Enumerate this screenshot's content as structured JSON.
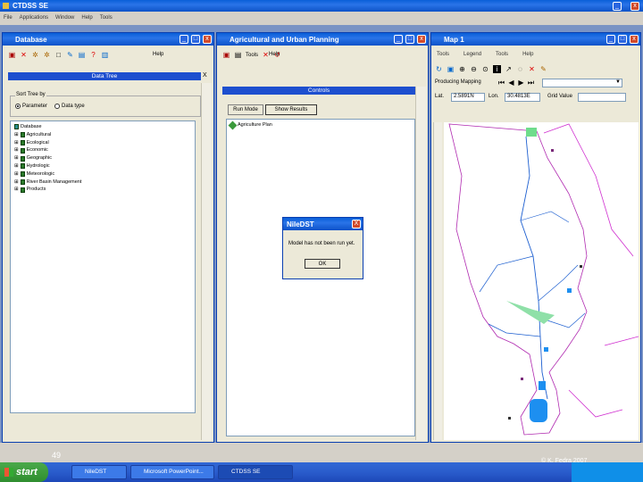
{
  "app": {
    "title": "CTDSS SE",
    "menu": [
      "File",
      "Applications",
      "Window",
      "Help",
      "Tools"
    ]
  },
  "database": {
    "title": "Database",
    "help": "Help",
    "data_tree_title": "Data Tree",
    "close_x": "X",
    "sort_label": "Sort Tree by",
    "radio_parameter": "Parameter",
    "radio_data_type": "Data type",
    "root": "Database",
    "items": [
      "Agricultural",
      "Ecological",
      "Economic",
      "Geographic",
      "Hydrologic",
      "Meteorologic",
      "River Basin Management",
      "Products"
    ]
  },
  "planning": {
    "title": "Agricultural and Urban Planning",
    "tools": "Tools",
    "help": "Help",
    "controls_title": "Controls",
    "close_x": "X",
    "run_mode": "Run Mode",
    "show_results": "Show Results",
    "tree_item": "Agriculture Plan"
  },
  "dialog": {
    "title": "NileDST",
    "close": "X",
    "message": "Model has not been run yet.",
    "ok": "OK"
  },
  "map": {
    "title": "Map 1",
    "menu": [
      "Tools",
      "Legend",
      "Tools",
      "Help"
    ],
    "producing_label": "Producing Mapping",
    "lat_label": "Lat.",
    "lat_value": "2.5891N",
    "lon_label": "Lon.",
    "lon_value": "30.4813E",
    "grid_label": "Grid Value"
  },
  "slide": {
    "page_number": "49",
    "copyright": "© K. Fedra 2007"
  },
  "taskbar": {
    "start": "start",
    "tasks": [
      "NileDST",
      "Microsoft PowerPoint...",
      "CTDSS SE"
    ]
  }
}
